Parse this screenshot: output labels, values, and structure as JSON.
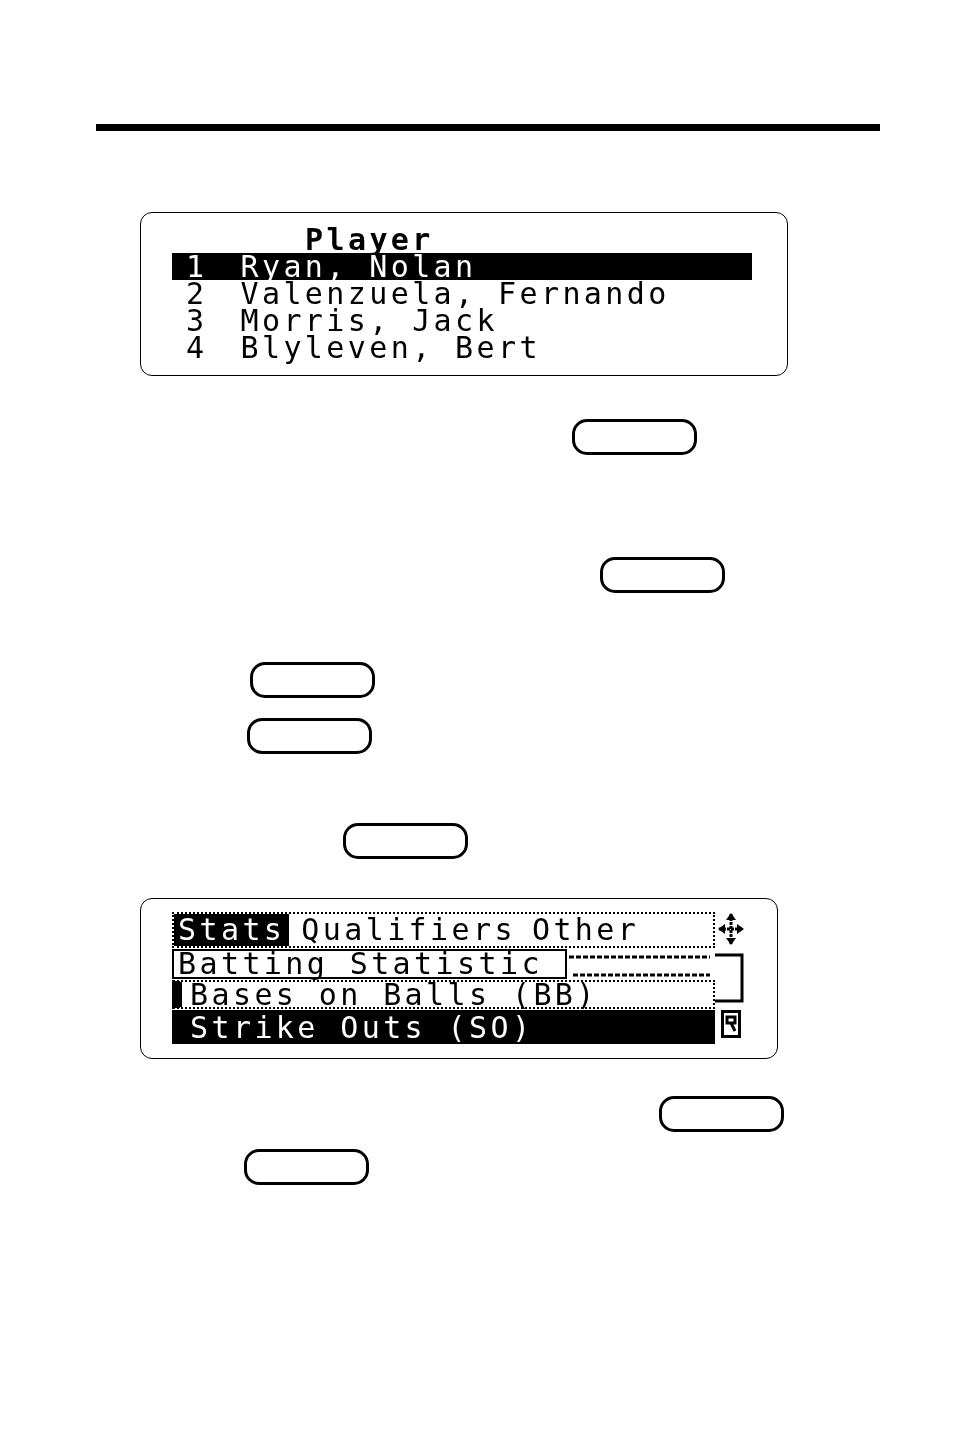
{
  "screens": [
    {
      "kind": "player_list",
      "title": "Player",
      "rows": [
        {
          "number": "1",
          "name": "Ryan, Nolan",
          "selected": true
        },
        {
          "number": "2",
          "name": "Valenzuela, Fernando",
          "selected": false
        },
        {
          "number": "3",
          "name": "Morris, Jack",
          "selected": false
        },
        {
          "number": "4",
          "name": "Blyleven, Bert",
          "selected": false
        }
      ]
    },
    {
      "kind": "stat_menu",
      "tabs": [
        {
          "label": "Stats",
          "selected": true
        },
        {
          "label": "Qualifiers",
          "selected": false
        },
        {
          "label": "Other",
          "selected": false
        }
      ],
      "category": {
        "value": "Batting Statistic"
      },
      "items": [
        {
          "label": "Bases on Balls (BB)",
          "selected": false
        },
        {
          "label": "Strike Outs (SO)",
          "selected": true
        }
      ]
    }
  ]
}
